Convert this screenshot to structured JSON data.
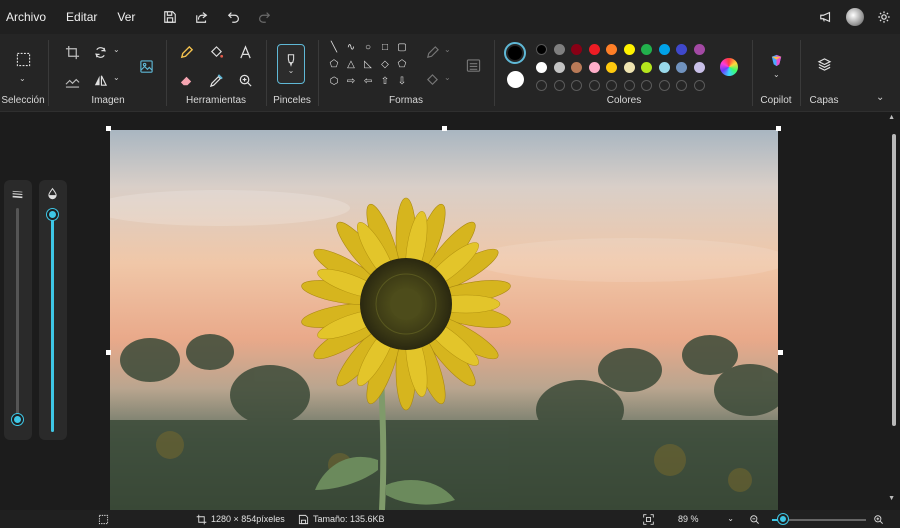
{
  "menu": {
    "file": "Archivo",
    "edit": "Editar",
    "view": "Ver"
  },
  "quick_actions": [
    "save-icon",
    "share-icon",
    "undo-icon",
    "redo-icon"
  ],
  "header_right_icons": [
    "megaphone-icon",
    "avatar",
    "gear-icon"
  ],
  "ribbon": {
    "selection": {
      "label": "Selección"
    },
    "image": {
      "label": "Imagen"
    },
    "tools": {
      "label": "Herramientas"
    },
    "brushes": {
      "label": "Pinceles"
    },
    "shapes": {
      "label": "Formas",
      "glyphs": [
        "╲",
        "∿",
        "○",
        "□",
        "▢",
        "⬠",
        "△",
        "◺",
        "◇",
        "⬠",
        "⬡",
        "⇨",
        "⇦",
        "⇧",
        "⇩",
        "☆",
        "☆",
        "✦",
        "▭",
        "◯"
      ]
    },
    "colors": {
      "label": "Colores",
      "primary": "#000000",
      "secondary": "#ffffff",
      "row1": [
        "#000000",
        "#7f7f7f",
        "#880015",
        "#ed1c24",
        "#ff7f27",
        "#fff200",
        "#22b14c",
        "#00a2e8",
        "#3f48cc",
        "#a349a4"
      ],
      "row2": [
        "#ffffff",
        "#c3c3c3",
        "#b97a57",
        "#ffaec9",
        "#ffc90e",
        "#efe4b0",
        "#b5e61d",
        "#99d9ea",
        "#7092be",
        "#c8bfe7"
      ]
    },
    "copilot": {
      "label": "Copilot"
    },
    "layers": {
      "label": "Capas"
    }
  },
  "sliders": {
    "size": {
      "value": 0.03,
      "icon": "line-thickness-icon"
    },
    "opacity": {
      "value": 1.0,
      "icon": "opacity-drop-icon"
    }
  },
  "status": {
    "dimensions": "1280 × 854píxeles",
    "size": "Tamaño: 135.6KB",
    "zoom": "89 %"
  },
  "colors": {
    "accent": "#3ec7e6",
    "background": "#1c1c1c",
    "ribbon": "#252525"
  }
}
